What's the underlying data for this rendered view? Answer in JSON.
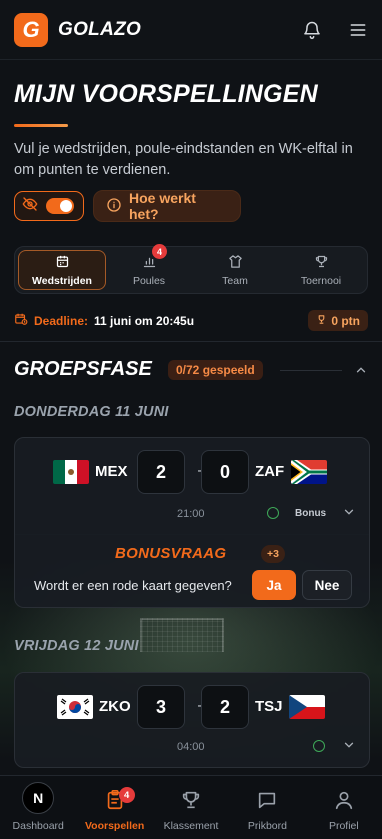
{
  "header": {
    "logo_letter": "G",
    "app_name": "GOLAZO"
  },
  "page": {
    "title": "MIJN VOORSPELLINGEN",
    "subtitle": "Vul je wedstrijden, poule-eindstanden en WK-elftal in om punten te verdienen.",
    "how_button": "Hoe werkt het?"
  },
  "tabs": [
    {
      "label": "Wedstrijden",
      "icon": "calendar-icon",
      "active": true
    },
    {
      "label": "Poules",
      "icon": "bar-chart-icon",
      "badge": "4"
    },
    {
      "label": "Team",
      "icon": "shirt-icon"
    },
    {
      "label": "Toernooi",
      "icon": "trophy-icon"
    }
  ],
  "deadline": {
    "label": "Deadline:",
    "value": "11 juni om 20:45u"
  },
  "points": "0 ptn",
  "group": {
    "title": "GROEPSFASE",
    "played": "0/72 gespeeld"
  },
  "days": [
    {
      "label": "DONDERDAG 11 JUNI",
      "match": {
        "home_code": "MEX",
        "away_code": "ZAF",
        "home_score": "2",
        "away_score": "0",
        "time": "21:00",
        "bonus_label": "Bonus"
      },
      "bonus": {
        "title": "BONUSVRAAG",
        "points": "+3",
        "question": "Wordt er een rode kaart gegeven?",
        "yes": "Ja",
        "no": "Nee"
      }
    },
    {
      "label": "VRIJDAG 12 JUNI",
      "match": {
        "home_code": "ZKO",
        "away_code": "TSJ",
        "home_score": "3",
        "away_score": "2",
        "time": "04:00"
      }
    }
  ],
  "bottom_nav": [
    {
      "label": "Dashboard",
      "icon": "avatar-n",
      "avatar_letter": "N"
    },
    {
      "label": "Voorspellen",
      "icon": "clipboard-icon",
      "active": true,
      "badge": "4"
    },
    {
      "label": "Klassement",
      "icon": "trophy-icon"
    },
    {
      "label": "Prikbord",
      "icon": "chat-icon"
    },
    {
      "label": "Profiel",
      "icon": "user-icon"
    }
  ],
  "colors": {
    "accent": "#f26a1b",
    "background": "#0f1216",
    "badge_red": "#e53b3b",
    "success_green": "#3ea858"
  }
}
